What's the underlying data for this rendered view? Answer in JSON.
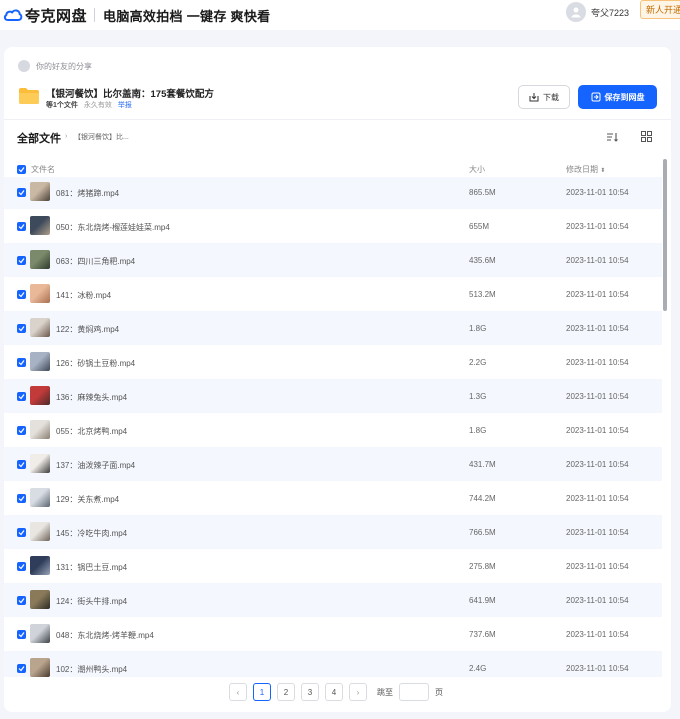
{
  "header": {
    "logo_text": "夸克网盘",
    "slogan": "电脑高效拍档  一键存 爽快看",
    "user_name": "夸父7223",
    "vip_label": "新人开通会员"
  },
  "share": {
    "from_label": "你的好友的分享",
    "title": "【银河餐饮】比尔盖南：175套餐饮配方",
    "count_label": "等1个文件",
    "validity": "永久有效",
    "report_label": "举报",
    "download_label": "下载",
    "save_label": "保存到网盘"
  },
  "toolbar": {
    "all_files_label": "全部文件",
    "breadcrumb_arrow": "›",
    "breadcrumb_item": "【银河餐饮】比..."
  },
  "table": {
    "col_name": "文件名",
    "col_size": "大小",
    "col_date": "修改日期",
    "rows": [
      {
        "name": "081：烤猪蹄.mp4",
        "size": "865.5M",
        "date": "2023-11-01 10:54",
        "thumb": [
          "#c9b8a3",
          "#4a4038"
        ]
      },
      {
        "name": "050：东北烧烤-榴莲娃娃菜.mp4",
        "size": "655M",
        "date": "2023-11-01 10:54",
        "thumb": [
          "#3d4a5c",
          "#b0a08a"
        ]
      },
      {
        "name": "063：四川三角粑.mp4",
        "size": "435.6M",
        "date": "2023-11-01 10:54",
        "thumb": [
          "#7a8a6a",
          "#2e3a2c"
        ]
      },
      {
        "name": "141：冰粉.mp4",
        "size": "513.2M",
        "date": "2023-11-01 10:54",
        "thumb": [
          "#e8b899",
          "#a96e4e"
        ]
      },
      {
        "name": "122：黄焖鸡.mp4",
        "size": "1.8G",
        "date": "2023-11-01 10:54",
        "thumb": [
          "#d9d3cc",
          "#6a5548"
        ]
      },
      {
        "name": "126：砂锅土豆粉.mp4",
        "size": "2.2G",
        "date": "2023-11-01 10:54",
        "thumb": [
          "#a7b3c4",
          "#3e4656"
        ]
      },
      {
        "name": "136：麻辣兔头.mp4",
        "size": "1.3G",
        "date": "2023-11-01 10:54",
        "thumb": [
          "#c23a3a",
          "#4b2a2a"
        ]
      },
      {
        "name": "055：北京烤鸭.mp4",
        "size": "1.8G",
        "date": "2023-11-01 10:54",
        "thumb": [
          "#e4e1dc",
          "#8a7d70"
        ]
      },
      {
        "name": "137：油泼辣子面.mp4",
        "size": "431.7M",
        "date": "2023-11-01 10:54",
        "thumb": [
          "#f0ede8",
          "#3a3a3a"
        ]
      },
      {
        "name": "129：关东煮.mp4",
        "size": "744.2M",
        "date": "2023-11-01 10:54",
        "thumb": [
          "#d8dde4",
          "#5a6470"
        ]
      },
      {
        "name": "145：冷吃牛肉.mp4",
        "size": "766.5M",
        "date": "2023-11-01 10:54",
        "thumb": [
          "#e9e6e1",
          "#6e6258"
        ]
      },
      {
        "name": "131：锅巴土豆.mp4",
        "size": "275.8M",
        "date": "2023-11-01 10:54",
        "thumb": [
          "#2f3d5a",
          "#9aa4b8"
        ]
      },
      {
        "name": "124：街头牛排.mp4",
        "size": "641.9M",
        "date": "2023-11-01 10:54",
        "thumb": [
          "#8a7a5a",
          "#2c2a24"
        ]
      },
      {
        "name": "048：东北烧烤-烤羊鞭.mp4",
        "size": "737.6M",
        "date": "2023-11-01 10:54",
        "thumb": [
          "#d0d4da",
          "#3c4048"
        ]
      },
      {
        "name": "102：潮州鸭头.mp4",
        "size": "2.4G",
        "date": "2023-11-01 10:54",
        "thumb": [
          "#b9a48e",
          "#4a3a2e"
        ]
      }
    ]
  },
  "pagination": {
    "prev": "‹",
    "pages": [
      "1",
      "2",
      "3",
      "4"
    ],
    "next": "›",
    "jump_label": "跳至",
    "page_unit": "页"
  },
  "colors": {
    "accent": "#1664ff",
    "row_bg": "#f4f7fe"
  }
}
